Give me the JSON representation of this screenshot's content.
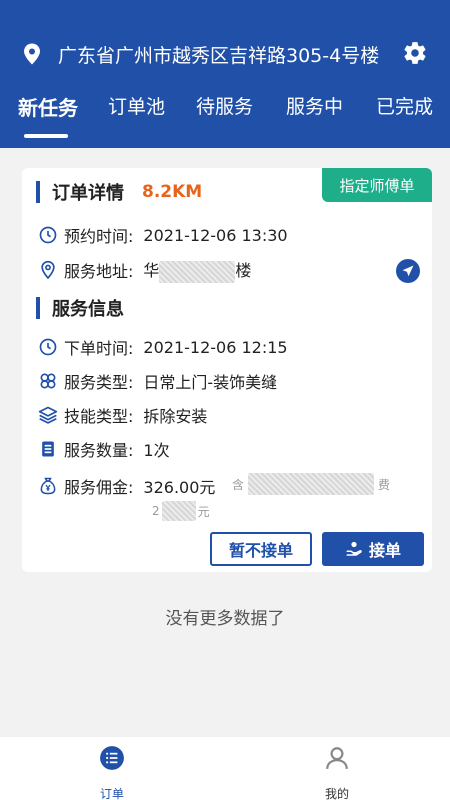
{
  "header": {
    "location": "广东省广州市越秀区吉祥路305-4号楼",
    "tabs": [
      {
        "label": "新任务",
        "active": true
      },
      {
        "label": "订单池",
        "active": false
      },
      {
        "label": "待服务",
        "active": false
      },
      {
        "label": "服务中",
        "active": false
      },
      {
        "label": "已完成",
        "active": false
      }
    ]
  },
  "order": {
    "badge": "指定师傅单",
    "detail_title": "订单详情",
    "distance": "8.2KM",
    "appointment_label": "预约时间:",
    "appointment_value": "2021-12-06 13:30",
    "address_label": "服务地址:",
    "address_prefix": "华",
    "address_suffix": "楼",
    "info_title": "服务信息",
    "order_time_label": "下单时间:",
    "order_time_value": "2021-12-06 12:15",
    "service_type_label": "服务类型:",
    "service_type_value": "日常上门-装饰美缝",
    "skill_label": "技能类型:",
    "skill_value": "拆除安装",
    "quantity_label": "服务数量:",
    "quantity_value": "1次",
    "commission_label": "服务佣金:",
    "commission_value": "326.00元",
    "fee_prefix": "含",
    "fee_suffix": "费",
    "fee_line2_prefix": "2",
    "fee_line2_suffix": "元",
    "reject_label": "暂不接单",
    "accept_label": "接单"
  },
  "footer_message": "没有更多数据了",
  "bottom_nav": {
    "orders_label": "订单",
    "mine_label": "我的"
  },
  "colors": {
    "primary": "#2050a8",
    "accent": "#e8641b",
    "badge": "#1fae8a"
  }
}
